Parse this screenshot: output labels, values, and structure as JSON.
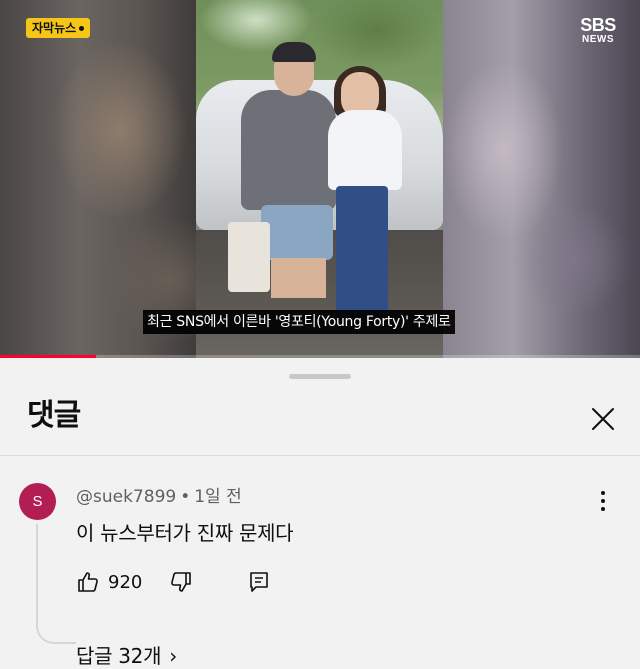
{
  "video": {
    "badge_label": "자막뉴스",
    "channel_logo_line1": "SBS",
    "channel_logo_line2": "NEWS",
    "subtitle": "최근 SNS에서 이른바 '영포티(Young Forty)' 주제로",
    "progress_fraction": 0.15,
    "progress_color": "#ff0033",
    "badge_color": "#f5c518"
  },
  "comments_sheet": {
    "title": "댓글",
    "close_icon": "close-icon",
    "comment": {
      "avatar_letter": "S",
      "avatar_color": "#b21d52",
      "author": "@suek7899",
      "separator": "•",
      "time": "1일 전",
      "text": "이 뉴스부터가 진짜 문제다",
      "like_count": "920",
      "replies_label": "답글 32개",
      "replies_chevron": "›"
    }
  }
}
